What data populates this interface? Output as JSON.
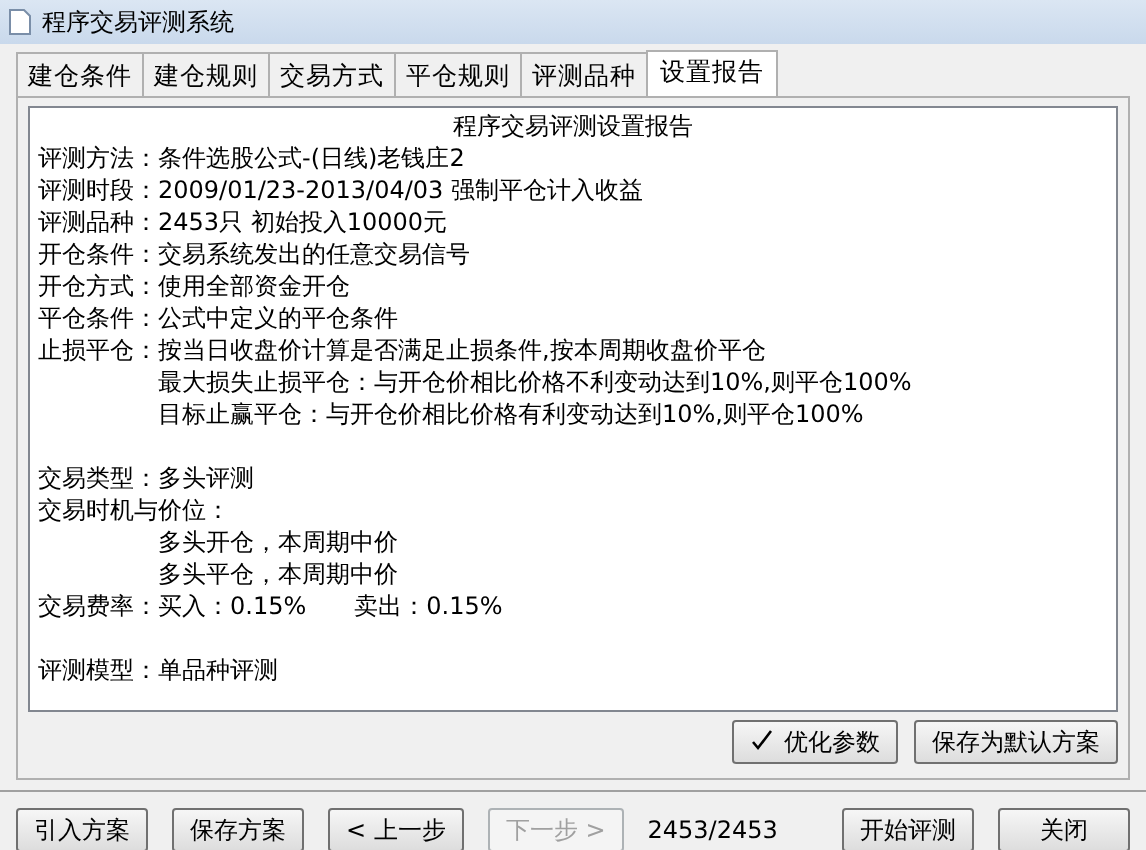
{
  "window": {
    "title": "程序交易评测系统"
  },
  "tabs": [
    {
      "label": "建仓条件",
      "selected": false
    },
    {
      "label": "建仓规则",
      "selected": false
    },
    {
      "label": "交易方式",
      "selected": false
    },
    {
      "label": "平仓规则",
      "selected": false
    },
    {
      "label": "评测品种",
      "selected": false
    },
    {
      "label": "设置报告",
      "selected": true
    }
  ],
  "report": {
    "title": "程序交易评测设置报告",
    "lines": [
      {
        "kind": "field",
        "label": "评测方法：",
        "values": [
          "条件选股公式-(日线)老钱庄2"
        ]
      },
      {
        "kind": "field",
        "label": "评测时段：",
        "values": [
          "2009/01/23-2013/04/03 强制平仓计入收益"
        ]
      },
      {
        "kind": "field",
        "label": "评测品种：",
        "values": [
          "2453只 初始投入10000元"
        ]
      },
      {
        "kind": "field",
        "label": "开仓条件：",
        "values": [
          "交易系统发出的任意交易信号"
        ]
      },
      {
        "kind": "field",
        "label": "开仓方式：",
        "values": [
          "使用全部资金开仓"
        ]
      },
      {
        "kind": "field",
        "label": "平仓条件：",
        "values": [
          "公式中定义的平仓条件"
        ]
      },
      {
        "kind": "field",
        "label": "止损平仓：",
        "values": [
          "按当日收盘价计算是否满足止损条件,按本周期收盘价平仓"
        ]
      },
      {
        "kind": "indent",
        "values": [
          "最大损失止损平仓：与开仓价相比价格不利变动达到10%,则平仓100%"
        ]
      },
      {
        "kind": "indent",
        "values": [
          "目标止赢平仓：与开仓价相比价格有利变动达到10%,则平仓100%"
        ]
      },
      {
        "kind": "blank"
      },
      {
        "kind": "field",
        "label": "交易类型：",
        "values": [
          "多头评测"
        ]
      },
      {
        "kind": "field",
        "label": "交易时机与价位："
      },
      {
        "kind": "indent",
        "values": [
          "多头开仓，本周期中价"
        ]
      },
      {
        "kind": "indent",
        "values": [
          "多头平仓，本周期中价"
        ]
      },
      {
        "kind": "field",
        "label": "交易费率：",
        "values": [
          "买入：0.15%",
          "卖出：0.15%"
        ]
      },
      {
        "kind": "blank"
      },
      {
        "kind": "field",
        "label": "评测模型：",
        "values": [
          "单品种评测"
        ]
      }
    ]
  },
  "panel_buttons": [
    {
      "label": "优化参数",
      "kind": "optimize"
    },
    {
      "label": "保存为默认方案",
      "kind": "save"
    }
  ],
  "footer": {
    "buttons": [
      {
        "label": "引入方案",
        "disabled": false
      },
      {
        "label": "保存方案",
        "disabled": false
      },
      {
        "label": "< 上一步",
        "disabled": false
      },
      {
        "label": "下一步 >",
        "disabled": true
      }
    ],
    "counter": "2453/2453",
    "right_buttons": [
      {
        "label": "开始评测",
        "disabled": false
      },
      {
        "label": "关闭",
        "disabled": false
      }
    ]
  }
}
